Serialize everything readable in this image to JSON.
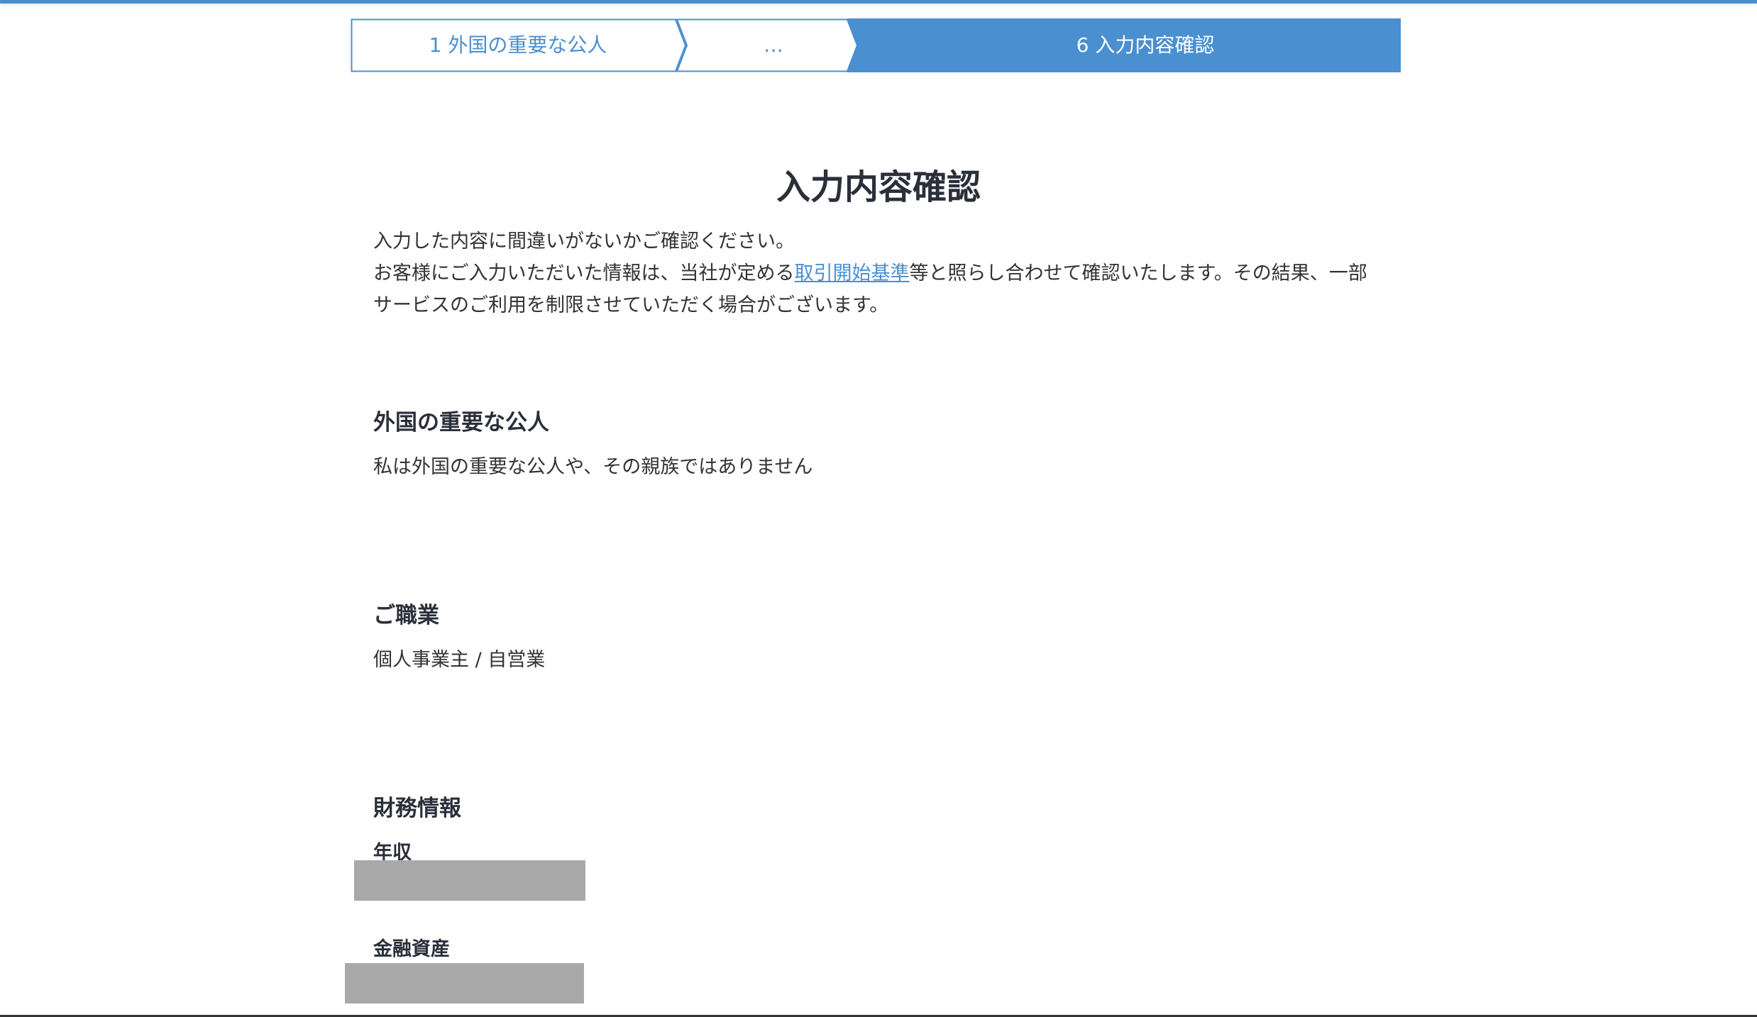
{
  "stepper": {
    "steps": [
      {
        "label": "1 外国の重要な公人",
        "state": "done"
      },
      {
        "label": "…",
        "state": "collapsed"
      },
      {
        "label": "6 入力内容確認",
        "state": "current"
      }
    ],
    "accent_color": "#4a8fd0"
  },
  "page": {
    "title": "入力内容確認",
    "intro_line1": "入力した内容に間違いがないかご確認ください。",
    "intro_line2_before": "お客様にご入力いただいた情報は、当社が定める",
    "intro_link": "取引開始基準",
    "intro_line2_after": "等と照らし合わせて確認いたします。その結果、一部サービスのご利用を制限させていただく場合がございます。"
  },
  "sections": {
    "pep": {
      "heading": "外国の重要な公人",
      "value": "私は外国の重要な公人や、その親族ではありません"
    },
    "occupation": {
      "heading": "ご職業",
      "value": "個人事業主 / 自営業"
    },
    "financial": {
      "heading": "財務情報",
      "annual_income_label": "年収",
      "financial_assets_label": "金融資産",
      "redacted_color": "#a9a9a9"
    }
  }
}
